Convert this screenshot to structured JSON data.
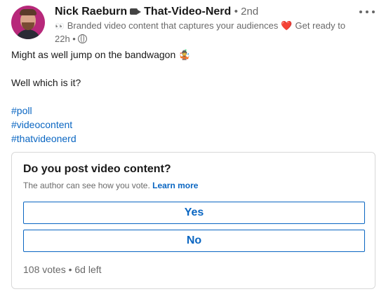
{
  "header": {
    "author_name": "Nick Raeburn",
    "author_tag": "That-Video-Nerd",
    "degree": "• 2nd",
    "headline_emoji": "👀",
    "headline_text": "Branded video content that captures your audiences",
    "headline_heart": "❤️",
    "headline_rest": "Get ready to l...",
    "time": "22h •"
  },
  "post": {
    "line1": "Might as well jump on the bandwagon 🤹",
    "line2": "Well which is it?",
    "hashtags": [
      "#poll",
      "#videocontent",
      "#thatvideonerd"
    ]
  },
  "poll": {
    "question": "Do you post video content?",
    "subtitle": "The author can see how you vote.",
    "learn_more": "Learn more",
    "options": [
      "Yes",
      "No"
    ],
    "footer": "108 votes • 6d left"
  },
  "colors": {
    "link": "#0a66c2",
    "secondary_text": "#666666"
  }
}
